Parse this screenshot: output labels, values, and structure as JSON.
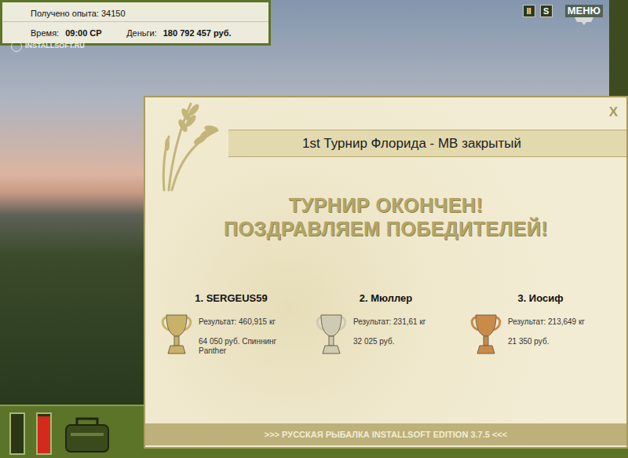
{
  "hud": {
    "experience": "Получено опыта: 34150",
    "time_label": "Время:",
    "time": "09:00 СР",
    "money_label": "Деньги:",
    "money": "180 792 457 руб."
  },
  "watermark": "INSTALLSOFT.RU",
  "top_controls": {
    "pause": "II",
    "sound": "S",
    "menu": "МЕНЮ"
  },
  "dialog": {
    "title": "1st Турнир Флорида - МВ закрытый",
    "close": "X",
    "headline": [
      "ТУРНИР ОКОНЧЕН!",
      "ПОЗДРАВЛЯЕМ ПОБЕДИТЕЛЕЙ!"
    ],
    "winners": [
      {
        "place": "1. SERGEUS59",
        "result": "Результат: 460,915 кг",
        "prize": "64 050 руб. Спиннинг Panther",
        "color": "#c8b26a"
      },
      {
        "place": "2. Мюллер",
        "result": "Результат: 231,61 кг",
        "prize": "32 025 руб.",
        "color": "#cfcab4"
      },
      {
        "place": "3. Иосиф",
        "result": "Результат: 213,649 кг",
        "prize": "21 350 руб.",
        "color": "#c98a4a"
      }
    ],
    "footer": ">>> РУССКАЯ РЫБАЛКА INSTALLSOFT EDITION 3.7.5 <<<"
  },
  "meters": [
    {
      "level": 0.0,
      "color": "#202020"
    },
    {
      "level": 0.95,
      "color": "#d42a1c"
    }
  ]
}
